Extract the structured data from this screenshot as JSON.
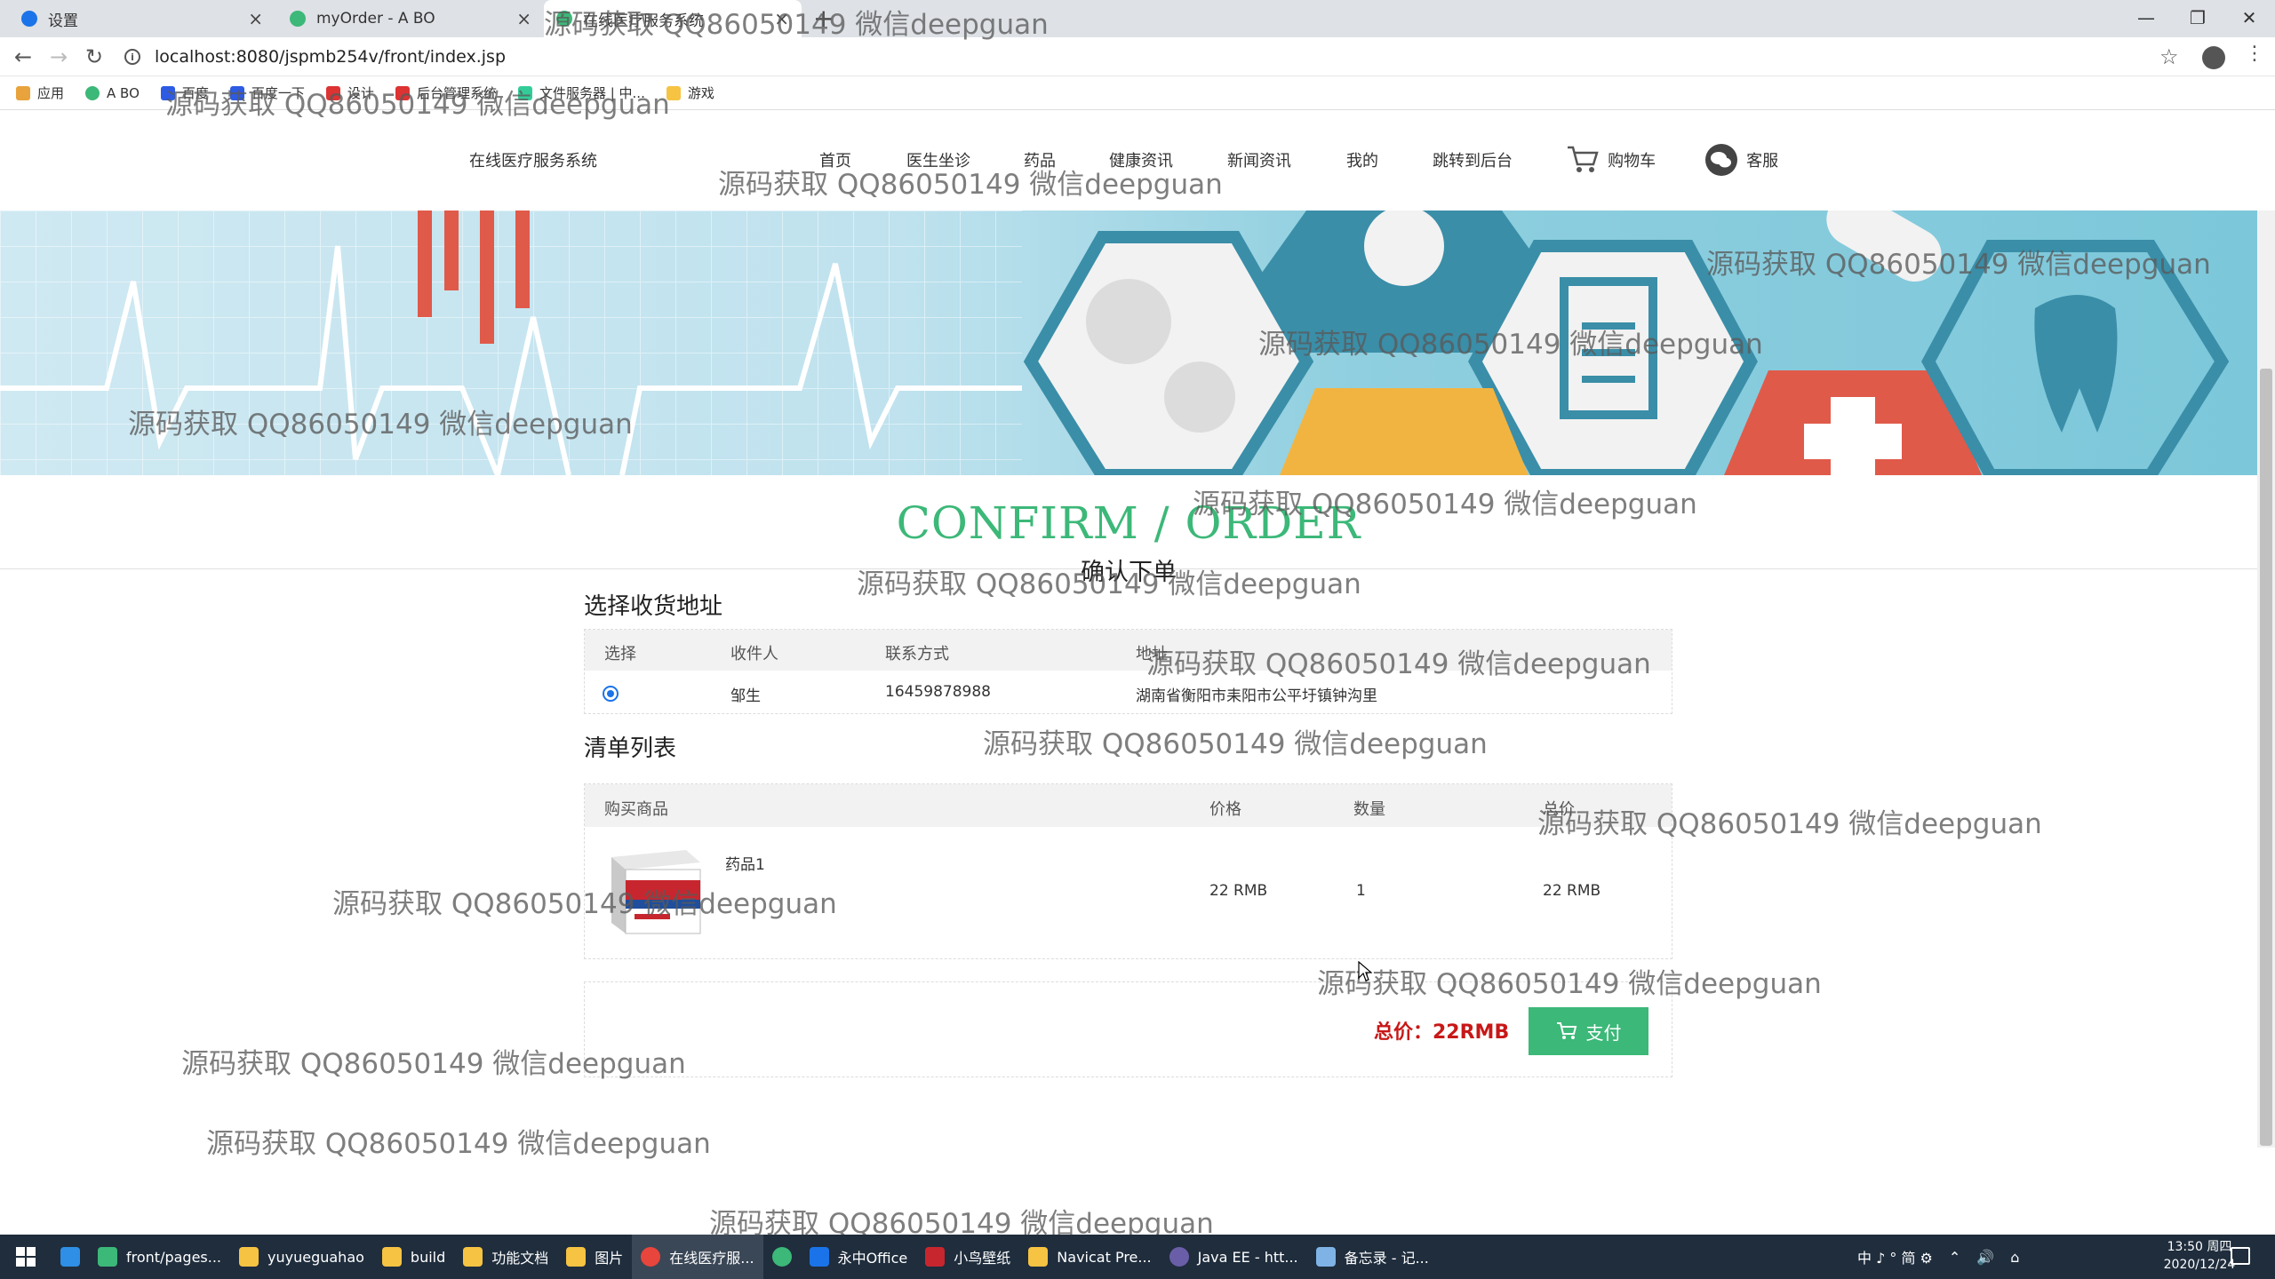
{
  "browser": {
    "tabs": [
      {
        "title": "设置",
        "close": "×"
      },
      {
        "title": "myOrder - A BO",
        "close": "×"
      },
      {
        "title": "在线医疗服务系统",
        "close": "×"
      }
    ],
    "new_tab": "+",
    "window_controls": {
      "minimize": "—",
      "maximize": "❐",
      "close": "✕"
    },
    "url": "localhost:8080/jspmb254v/front/index.jsp",
    "bookmarks": [
      "应用",
      "A BO",
      "百度",
      "百度一下",
      "设计",
      "后台管理系统",
      "文件服务器 | 中...",
      "游戏"
    ]
  },
  "site": {
    "brand": "在线医疗服务系统",
    "menu": [
      "首页",
      "医生坐诊",
      "药品",
      "健康资讯",
      "新闻资讯",
      "我的",
      "跳转到后台"
    ],
    "cart_label": "购物车",
    "service_label": "客服"
  },
  "page": {
    "title_en": "CONFIRM / ORDER",
    "title_cn": "确认下单"
  },
  "address": {
    "section_title": "选择收货地址",
    "columns": [
      "选择",
      "收件人",
      "联系方式",
      "地址"
    ],
    "rows": [
      {
        "selected": true,
        "recipient": "邹生",
        "phone": "16459878988",
        "address": "湖南省衡阳市耒阳市公平圩镇钟沟里"
      }
    ]
  },
  "order": {
    "section_title": "清单列表",
    "columns": [
      "购买商品",
      "价格",
      "数量",
      "总价"
    ],
    "items": [
      {
        "name": "药品1",
        "price": "22 RMB",
        "qty": "1",
        "total": "22 RMB"
      }
    ],
    "total_label": "总价：22RMB",
    "pay_label": "支付"
  },
  "watermark": "源码获取 QQ86050149 微信deepguan",
  "taskbar": {
    "items": [
      "front/pages...",
      "yuyueguahao",
      "build",
      "功能文档",
      "图片",
      "在线医疗服...",
      "",
      "永中Office",
      "小鸟壁纸",
      "Navicat Pre...",
      "Java EE - htt...",
      "备忘录 - 记..."
    ],
    "tray": "中 ♪ ° 简 ⚙",
    "time": "13:50 周四",
    "date": "2020/12/24"
  },
  "colors": {
    "accent_green": "#3cb878",
    "total_red": "#c81818",
    "taskbar": "#1f2d3d"
  }
}
